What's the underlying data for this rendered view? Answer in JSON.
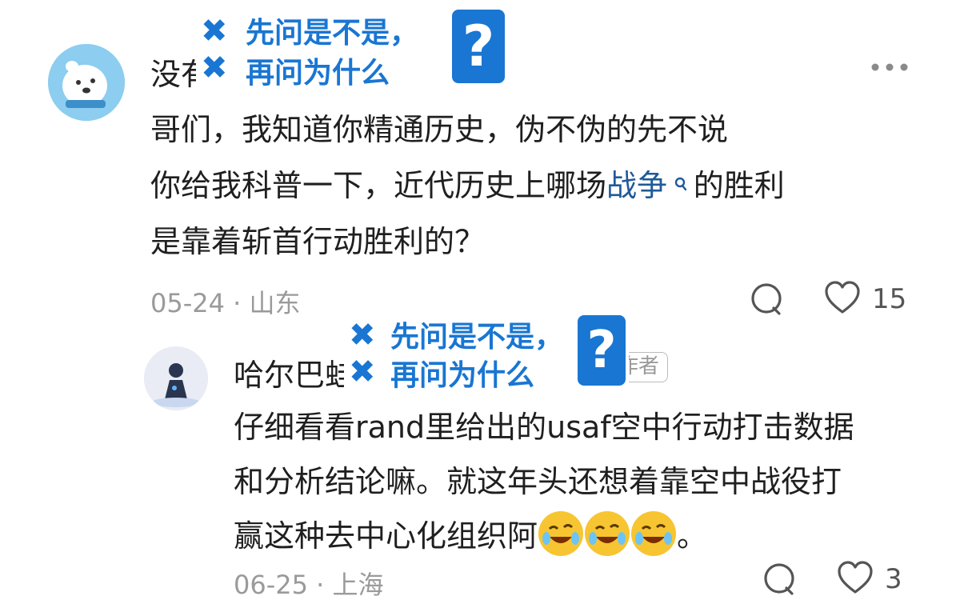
{
  "comment": {
    "username_visible": "没有",
    "body_line1": "哥们，我知道你精通历史，伪不伪的先不说",
    "body_line2_pre": "你给我科普一下，近代历史上哪场",
    "body_line2_link": "战争",
    "body_line2_post": "的胜利",
    "body_line3": "是靠着斩首行动胜利的？",
    "meta": "05-24 · 山东",
    "like_count": "15",
    "more_icon": "more-dots-icon",
    "search_icon": "search-icon"
  },
  "reply": {
    "username_visible": "哈尔巴蛙",
    "author_badge": "作者",
    "body_line1": "仔细看看rand里给出的usaf空中行动打击数据",
    "body_line2": "和分析结论嘛。就这年头还想着靠空中战役打",
    "body_line3": "赢这种去中心化组织阿",
    "body_line3_end": "。",
    "emojis": [
      "rofl-emoji",
      "rofl-emoji",
      "rofl-emoji"
    ],
    "meta": "06-25 · 上海",
    "like_count": "3"
  },
  "overlay_sticker": {
    "line1": "先问是不是，",
    "line2": "再问为什么",
    "question_mark": "?"
  },
  "icons": {
    "comment": "comment-bubble-icon",
    "like": "heart-icon",
    "cross": "cross-icon"
  },
  "colors": {
    "accent_blue": "#1976d2",
    "link_blue": "#1f5a99",
    "meta_gray": "#9a9a9a"
  }
}
